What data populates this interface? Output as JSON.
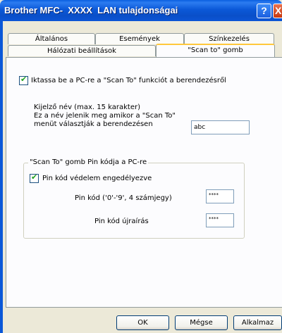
{
  "window": {
    "title": "Brother MFC-  XXXX  LAN tulajdonságai",
    "help_glyph": "?",
    "close_glyph": "X"
  },
  "tabs": {
    "row1": [
      "Általános",
      "Események",
      "Színkezelés"
    ],
    "row2": [
      "Hálózati beállítások",
      "\"Scan to\" gomb"
    ],
    "active": "\"Scan to\" gomb"
  },
  "main": {
    "enable_checkbox_label": "Iktassa be a PC-re a \"Scan To\" funkciót a berendezésről",
    "enable_checked": true,
    "display_name_text": "Kijelző név (max. 15 karakter)\nEz a név jelenik meg amikor a \"Scan To\"\nmenüt választják a berendezésen",
    "display_name_value": "abc",
    "group": {
      "title": "\"Scan To\" gomb Pin kódja a PC-re",
      "pin_enable_label": "Pin kód védelem engedélyezve",
      "pin_enable_checked": true,
      "pin_label": "Pin kód ('0'-'9', 4 számjegy)",
      "pin_value": "****",
      "pin_retype_label": "Pin kód újraírás",
      "pin_retype_value": "****"
    }
  },
  "buttons": {
    "ok": "OK",
    "cancel": "Mégse",
    "apply": "Alkalmaz"
  }
}
